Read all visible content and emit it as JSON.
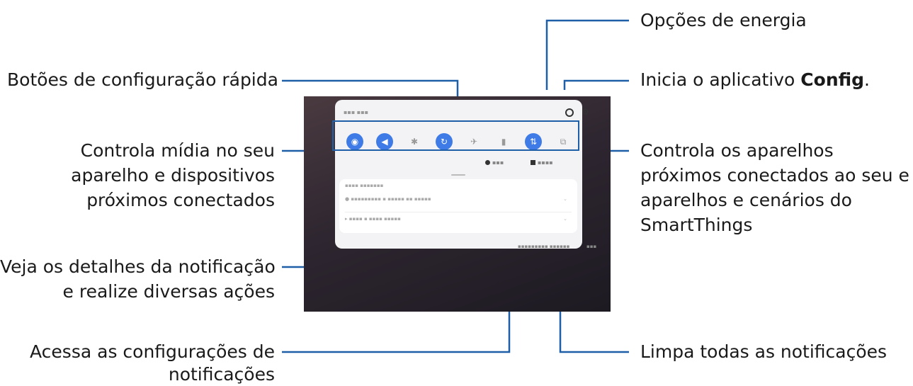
{
  "annotations": {
    "power_options": "Opções de energia",
    "quick_settings": "Botões de configuração rápida",
    "settings_prefix": "Inicia o aplicativo ",
    "settings_bold": "Config",
    "settings_suffix": ".",
    "media_line1": "Controla mídia no seu",
    "media_line2": "aparelho e dispositivos",
    "media_line3": "próximos conectados",
    "devices_line1": "Controla os aparelhos",
    "devices_line2": "próximos conectados ao seu e",
    "devices_line3": "aparelhos e cenários do",
    "devices_line4": "SmartThings",
    "notif_details_line1": "Veja os detalhes da notificação",
    "notif_details_line2": "e realize diversas ações",
    "notif_settings_line1": "Acessa as configurações de",
    "notif_settings_line2": "notificações",
    "clear_all": "Limpa todas as notificações"
  },
  "colors": {
    "callout_line": "#1f5fa8",
    "toggle_on": "#3e7be6"
  },
  "quick_panel": {
    "toggles": [
      {
        "icon": "wifi-icon",
        "state": "on"
      },
      {
        "icon": "sound-icon",
        "state": "on"
      },
      {
        "icon": "bluetooth-icon",
        "state": "off"
      },
      {
        "icon": "auto-rotate-icon",
        "state": "on"
      },
      {
        "icon": "airplane-icon",
        "state": "off"
      },
      {
        "icon": "flashlight-icon",
        "state": "off"
      },
      {
        "icon": "mobile-data-icon",
        "state": "on"
      },
      {
        "icon": "share-icon",
        "state": "off"
      }
    ]
  }
}
